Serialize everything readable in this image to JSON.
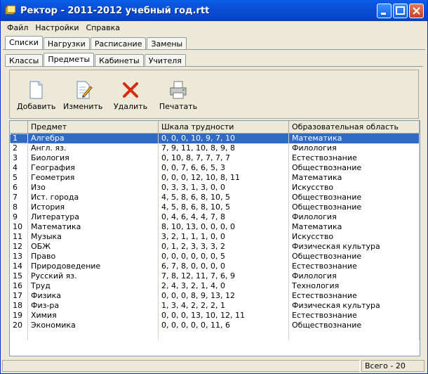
{
  "window": {
    "title": "Ректор - 2011-2012 учебный год.rtt"
  },
  "menu": [
    "Файл",
    "Настройки",
    "Справка"
  ],
  "main_tabs": [
    "Списки",
    "Нагрузки",
    "Расписание",
    "Замены"
  ],
  "sub_tabs": [
    "Классы",
    "Предметы",
    "Кабинеты",
    "Учителя"
  ],
  "toolbar": {
    "add": "Добавить",
    "edit": "Изменить",
    "delete": "Удалить",
    "print": "Печатать"
  },
  "table": {
    "headers": [
      "",
      "Предмет",
      "Шкала трудности",
      "Образовательная область"
    ],
    "rows": [
      [
        "1",
        "Алгебра",
        "0, 0, 0, 10, 9, 7, 10",
        "Математика"
      ],
      [
        "2",
        "Англ. яз.",
        "7, 9, 11, 10, 8, 9, 8",
        "Филология"
      ],
      [
        "3",
        "Биология",
        "0, 10, 8, 7, 7, 7, 7",
        "Естествознание"
      ],
      [
        "4",
        "География",
        "0, 0, 7, 6, 6, 5, 3",
        "Обществознание"
      ],
      [
        "5",
        "Геометрия",
        "0, 0, 0, 12, 10, 8, 11",
        "Математика"
      ],
      [
        "6",
        "Изо",
        "0, 3, 3, 1, 3, 0, 0",
        "Искусство"
      ],
      [
        "7",
        "Ист. города",
        "4, 5, 8, 6, 8, 10, 5",
        "Обществознание"
      ],
      [
        "8",
        "История",
        "4, 5, 8, 6, 8, 10, 5",
        "Обществознание"
      ],
      [
        "9",
        "Литература",
        "0, 4, 6, 4, 4, 7, 8",
        "Филология"
      ],
      [
        "10",
        "Математика",
        "8, 10, 13, 0, 0, 0, 0",
        "Математика"
      ],
      [
        "11",
        "Музыка",
        "3, 2, 1, 1, 1, 0, 0",
        "Искусство"
      ],
      [
        "12",
        "ОБЖ",
        "0, 1, 2, 3, 3, 3, 2",
        "Физическая культура"
      ],
      [
        "13",
        "Право",
        "0, 0, 0, 0, 0, 0, 5",
        "Обществознание"
      ],
      [
        "14",
        "Природоведение",
        "6, 7, 8, 0, 0, 0, 0",
        "Естествознание"
      ],
      [
        "15",
        "Русский яз.",
        "7, 8, 12, 11, 7, 6, 9",
        "Филология"
      ],
      [
        "16",
        "Труд",
        "2, 4, 3, 2, 1, 4, 0",
        "Технология"
      ],
      [
        "17",
        "Физика",
        "0, 0, 0, 8, 9, 13, 12",
        "Естествознание"
      ],
      [
        "18",
        "Физ-ра",
        "1, 3, 4, 2, 2, 2, 1",
        "Физическая культура"
      ],
      [
        "19",
        "Химия",
        "0, 0, 0, 13, 10, 12, 11",
        "Естествознание"
      ],
      [
        "20",
        "Экономика",
        "0, 0, 0, 0, 0, 11, 6",
        "Обществознание"
      ]
    ]
  },
  "status": {
    "total": "Всего - 20"
  }
}
